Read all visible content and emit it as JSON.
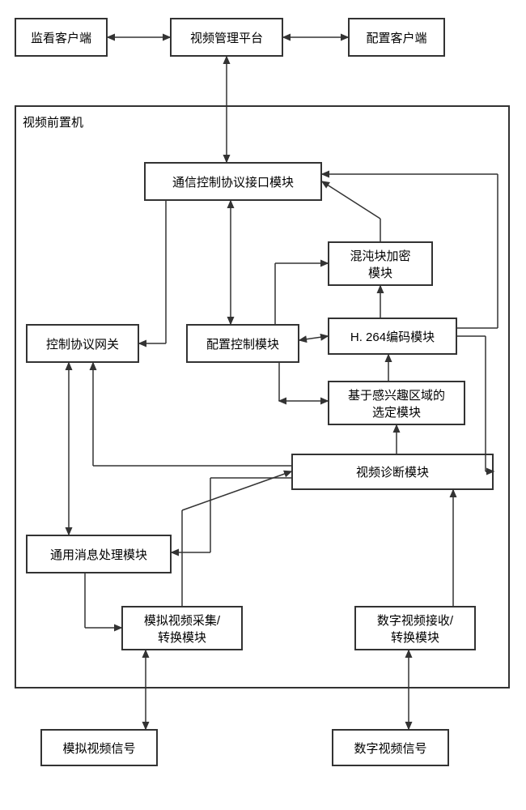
{
  "top": {
    "monitor_client": "监看客户端",
    "video_mgmt_platform": "视频管理平台",
    "config_client": "配置客户端"
  },
  "container_label": "视频前置机",
  "modules": {
    "comm_ctrl_iface": "通信控制协议接口模块",
    "chaos_block_enc": "混沌块加密\n模块",
    "ctrl_proto_gw": "控制协议网关",
    "config_ctrl": "配置控制模块",
    "h264_enc": "H. 264编码模块",
    "roi_select": "基于感兴趣区域的\n选定模块",
    "video_diag": "视频诊断模块",
    "generic_msg": "通用消息处理模块",
    "analog_capture": "模拟视频采集/\n转换模块",
    "digital_recv": "数字视频接收/\n转换模块"
  },
  "sources": {
    "analog_signal": "模拟视频信号",
    "digital_signal": "数字视频信号"
  }
}
